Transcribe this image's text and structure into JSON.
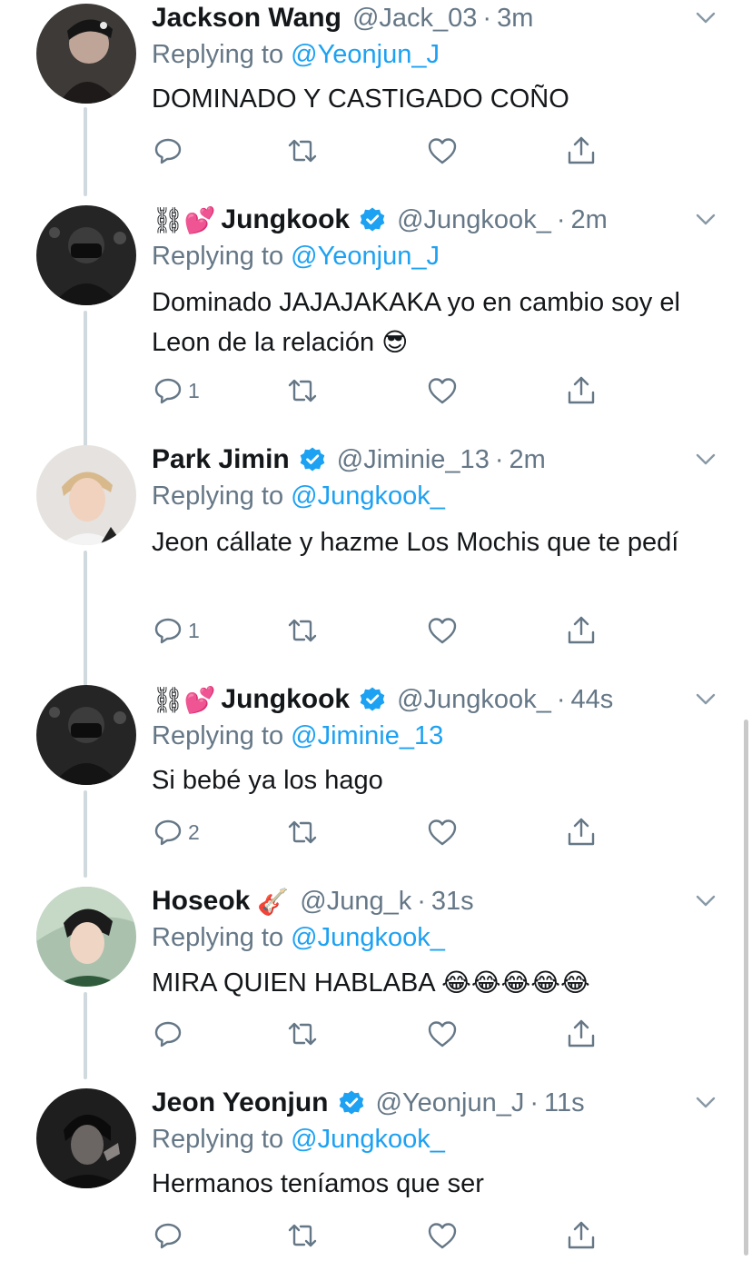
{
  "colors": {
    "name": "#14171a",
    "secondary": "#657786",
    "link": "#1da1f2",
    "thread": "#cfd9de"
  },
  "tweets": [
    {
      "name": "Jackson Wang",
      "emoji_prefix": "",
      "emoji_suffix": "",
      "verified": false,
      "handle": "@Jack_03",
      "dot": "·",
      "time": "3m",
      "replying_label": "Replying to",
      "replying_to": "@Yeonjun_J",
      "text": "DOMINADO Y CASTIGADO COÑO",
      "text_emoji": "",
      "reply_count": ""
    },
    {
      "name": "Jungkook",
      "emoji_prefix": "⛓💕",
      "emoji_suffix": "",
      "verified": true,
      "handle": "@Jungkook_",
      "dot": "·",
      "time": "2m",
      "replying_label": "Replying to",
      "replying_to": "@Yeonjun_J",
      "text": "Dominado JAJAJAKAKA yo en cambio soy el Leon de la relación",
      "text_emoji": "😎",
      "reply_count": "1"
    },
    {
      "name": "Park Jimin",
      "emoji_prefix": "",
      "emoji_suffix": "",
      "verified": true,
      "handle": "@Jiminie_13",
      "dot": "·",
      "time": "2m",
      "replying_label": "Replying to",
      "replying_to": "@Jungkook_",
      "text": "Jeon cállate y hazme Los Mochis que te pedí",
      "text_emoji": "",
      "reply_count": "1"
    },
    {
      "name": "Jungkook",
      "emoji_prefix": "⛓💕",
      "emoji_suffix": "",
      "verified": true,
      "handle": "@Jungkook_",
      "dot": "·",
      "time": "44s",
      "replying_label": "Replying to",
      "replying_to": "@Jiminie_13",
      "text": "Si bebé ya los hago",
      "text_emoji": "",
      "reply_count": "2"
    },
    {
      "name": "Hoseok",
      "emoji_prefix": "",
      "emoji_suffix": "🎸",
      "verified": false,
      "handle": "@Jung_k",
      "dot": "·",
      "time": "31s",
      "replying_label": "Replying to",
      "replying_to": "@Jungkook_",
      "text": "MIRA QUIEN HABLABA",
      "text_emoji": "😂😂😂😂😂",
      "reply_count": ""
    },
    {
      "name": "Jeon Yeonjun",
      "emoji_prefix": "",
      "emoji_suffix": "",
      "verified": true,
      "handle": "@Yeonjun_J",
      "dot": "·",
      "time": "11s",
      "replying_label": "Replying to",
      "replying_to": "@Jungkook_",
      "text": "Hermanos teníamos que ser",
      "text_emoji": "",
      "reply_count": ""
    }
  ]
}
